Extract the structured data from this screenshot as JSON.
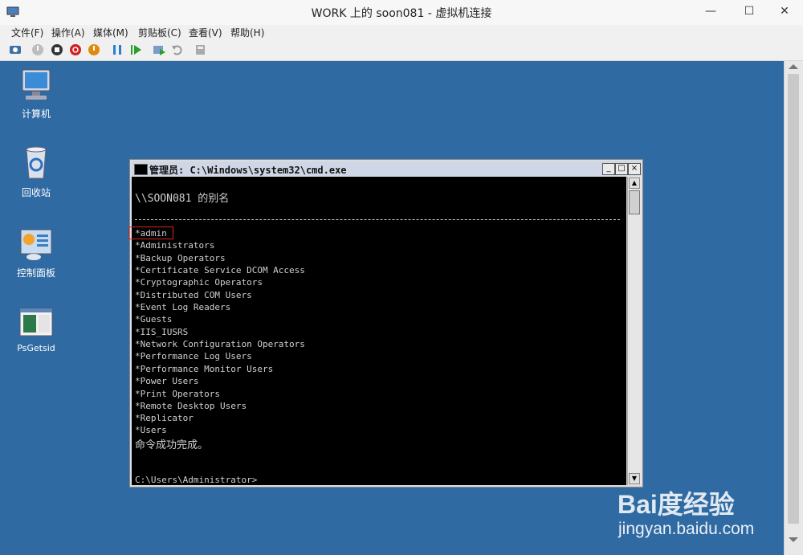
{
  "window": {
    "title": "WORK 上的 soon081 - 虚拟机连接",
    "minimize": "—",
    "maximize": "☐",
    "close": "✕"
  },
  "menu": [
    "文件(F)",
    "操作(A)",
    "媒体(M)",
    "剪贴板(C)",
    "查看(V)",
    "帮助(H)"
  ],
  "toolbar": {
    "icons": [
      "ctrl-alt-del-icon",
      "start-icon",
      "turnoff-icon",
      "shutdown-icon",
      "save-icon",
      "pause-icon",
      "resume-icon",
      "checkpoint-icon",
      "revert-icon",
      "share-icon"
    ]
  },
  "desktop": {
    "icons": [
      {
        "label": "计算机",
        "icon": "computer-icon"
      },
      {
        "label": "回收站",
        "icon": "recycle-bin-icon"
      },
      {
        "label": "控制面板",
        "icon": "control-panel-icon"
      },
      {
        "label": "PsGetsid",
        "icon": "app-icon"
      }
    ]
  },
  "console": {
    "title": "管理员: C:\\Windows\\system32\\cmd.exe",
    "min": "_",
    "max": "□",
    "close": "×",
    "header": "\\\\SOON081 的别名",
    "aliases": [
      "*admin",
      "*Administrators",
      "*Backup Operators",
      "*Certificate Service DCOM Access",
      "*Cryptographic Operators",
      "*Distributed COM Users",
      "*Event Log Readers",
      "*Guests",
      "*IIS_IUSRS",
      "*Network Configuration Operators",
      "*Performance Log Users",
      "*Performance Monitor Users",
      "*Power Users",
      "*Print Operators",
      "*Remote Desktop Users",
      "*Replicator",
      "*Users"
    ],
    "result": "命令成功完成。",
    "prompt": "C:\\Users\\Administrator>"
  },
  "watermark": {
    "brand": "Bai度经验",
    "url": "jingyan.baidu.com"
  },
  "colors": {
    "desktop": "#2f6aa3",
    "console_bg": "#000000",
    "console_text": "#d0d0d0",
    "highlight": "#dd2222"
  }
}
